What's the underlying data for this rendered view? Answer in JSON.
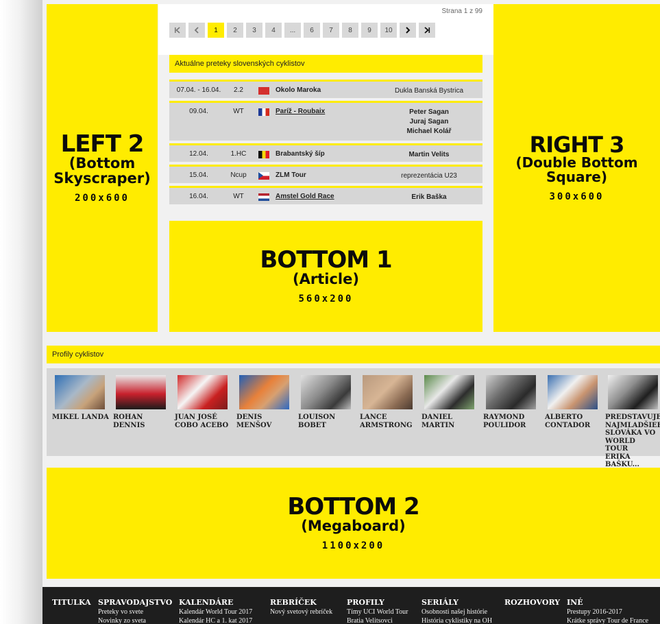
{
  "pager": {
    "page_count": "Strana 1 z 99",
    "buttons": [
      "1",
      "2",
      "3",
      "4",
      "...",
      "6",
      "7",
      "8",
      "9",
      "10"
    ],
    "first_icon": "first-page-icon",
    "prev_icon": "prev-page-icon",
    "next_icon": "next-page-icon",
    "last_icon": "last-page-icon"
  },
  "ads": {
    "left": {
      "title": "LEFT 2",
      "sub1": "(Bottom",
      "sub2": "Skyscraper)",
      "size": "200x600"
    },
    "right": {
      "title": "RIGHT 3",
      "sub1": "(Double Bottom",
      "sub2": "Square)",
      "size": "300x600"
    },
    "bottom1": {
      "title": "BOTTOM 1",
      "sub1": "(Article)",
      "size": "560x200"
    },
    "bottom2": {
      "title": "BOTTOM 2",
      "sub1": "(Megaboard)",
      "size": "1100x200"
    }
  },
  "races": {
    "header": "Aktuálne preteky slovenských cyklistov",
    "rows": [
      {
        "date": "07.04. - 16.04.",
        "cat": "2.2",
        "flag": "morocco-flag-icon",
        "name": "Okolo Maroka",
        "riders": [
          "Dukla Banská Bystrica"
        ]
      },
      {
        "date": "09.04.",
        "cat": "WT",
        "flag": "france-flag-icon",
        "name": "Paríž - Roubaix",
        "riders": [
          "Peter Sagan",
          "Juraj Sagan",
          "Michael Kolář"
        ]
      },
      {
        "date": "12.04.",
        "cat": "1.HC",
        "flag": "belgium-flag-icon",
        "name": "Brabantský šíp",
        "riders": [
          "Martin Velits"
        ]
      },
      {
        "date": "15.04.",
        "cat": "Ncup",
        "flag": "czech-flag-icon",
        "name": "ZLM Tour",
        "riders": [
          "reprezentácia U23"
        ]
      },
      {
        "date": "16.04.",
        "cat": "WT",
        "flag": "netherlands-flag-icon",
        "name": "Amstel Gold Race",
        "riders": [
          "Erik Baška"
        ]
      }
    ]
  },
  "profiles": {
    "header": "Profily cyklistov",
    "items": [
      {
        "line1": "MIKEL LANDA",
        "line2": ""
      },
      {
        "line1": "ROHAN",
        "line2": "DENNIS"
      },
      {
        "line1": "JUAN JOSÉ",
        "line2": "COBO ACEBO"
      },
      {
        "line1": "DENIS",
        "line2": "MENŠOV"
      },
      {
        "line1": "LOUISON",
        "line2": "BOBET"
      },
      {
        "line1": "LANCE",
        "line2": "ARMSTRONG"
      },
      {
        "line1": "DANIEL",
        "line2": "MARTIN"
      },
      {
        "line1": "RAYMOND",
        "line2": "POULIDOR"
      },
      {
        "line1": "ALBERTO",
        "line2": "CONTADOR"
      },
      {
        "line1": "PREDSTAVUJEM",
        "line2": "NAJMLADŠIEHO",
        "line3": "SLOVÁKA VO",
        "line4": "WORLD TOUR",
        "line5": "ERIKA BAŠKU..."
      }
    ]
  },
  "footer": {
    "cols": [
      {
        "head": "TITULKA",
        "links": []
      },
      {
        "head": "SPRAVODAJSTVO",
        "links": [
          "Preteky vo svete",
          "Novinky zo sveta"
        ]
      },
      {
        "head": "KALENDÁRE",
        "links": [
          "Kalendár World Tour 2017",
          "Kalendár HC a 1. kat 2017"
        ]
      },
      {
        "head": "REBRÍČEK",
        "links": [
          "Nový svetový rebríček"
        ]
      },
      {
        "head": "PROFILY",
        "links": [
          "Tímy UCI World Tour",
          "Bratia Velitsovci"
        ]
      },
      {
        "head": "SERIÁLY",
        "links": [
          "Osobnosti našej histórie",
          "História cyklistiky na OH"
        ]
      },
      {
        "head": "ROZHOVORY",
        "links": []
      },
      {
        "head": "INÉ",
        "links": [
          "Prestupy 2016-2017",
          "Krátke správy Tour de France"
        ]
      }
    ]
  },
  "colors": {
    "accent": "#ffec00",
    "row_bg": "#d6d6d6",
    "footer_bg": "#1e1e1e"
  }
}
